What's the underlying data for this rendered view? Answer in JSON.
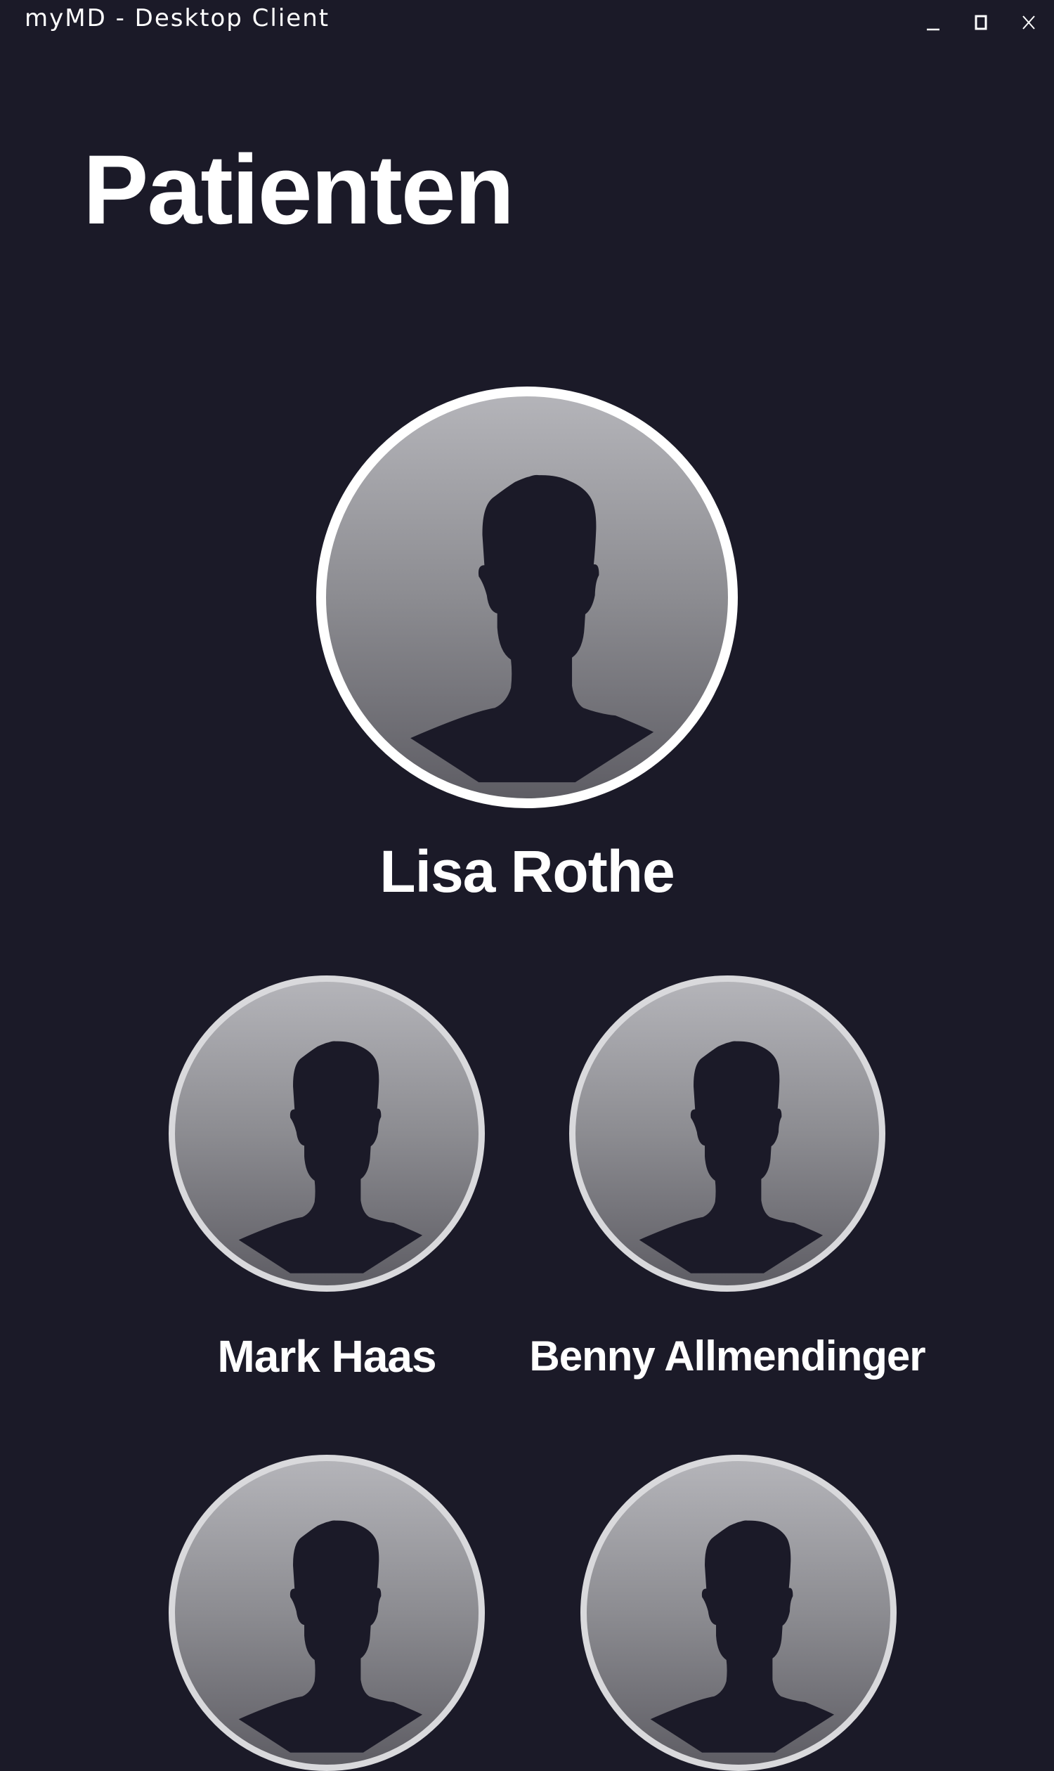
{
  "window": {
    "title": "myMD - Desktop Client",
    "minimize_icon": "minimize-icon",
    "maximize_icon": "maximize-icon",
    "close_icon": "close-icon"
  },
  "page": {
    "title": "Patienten"
  },
  "patients": [
    {
      "name": "Lisa Rothe",
      "selected": true,
      "avatar_icon": "person-silhouette-icon"
    },
    {
      "name": "Mark Haas",
      "selected": false,
      "avatar_icon": "person-silhouette-icon"
    },
    {
      "name": "Benny Allmendinger",
      "selected": false,
      "avatar_icon": "person-silhouette-icon"
    },
    {
      "name": "",
      "selected": false,
      "avatar_icon": "person-silhouette-icon"
    },
    {
      "name": "",
      "selected": false,
      "avatar_icon": "person-silhouette-icon"
    }
  ],
  "colors": {
    "background": "#1b1a28",
    "text": "#ffffff",
    "avatar_top": "#b4b4b9",
    "avatar_bottom": "#5e5d64",
    "selected_ring": "#ffffff",
    "normal_ring": "#d9d9dc",
    "silhouette": "#1b1a28"
  }
}
